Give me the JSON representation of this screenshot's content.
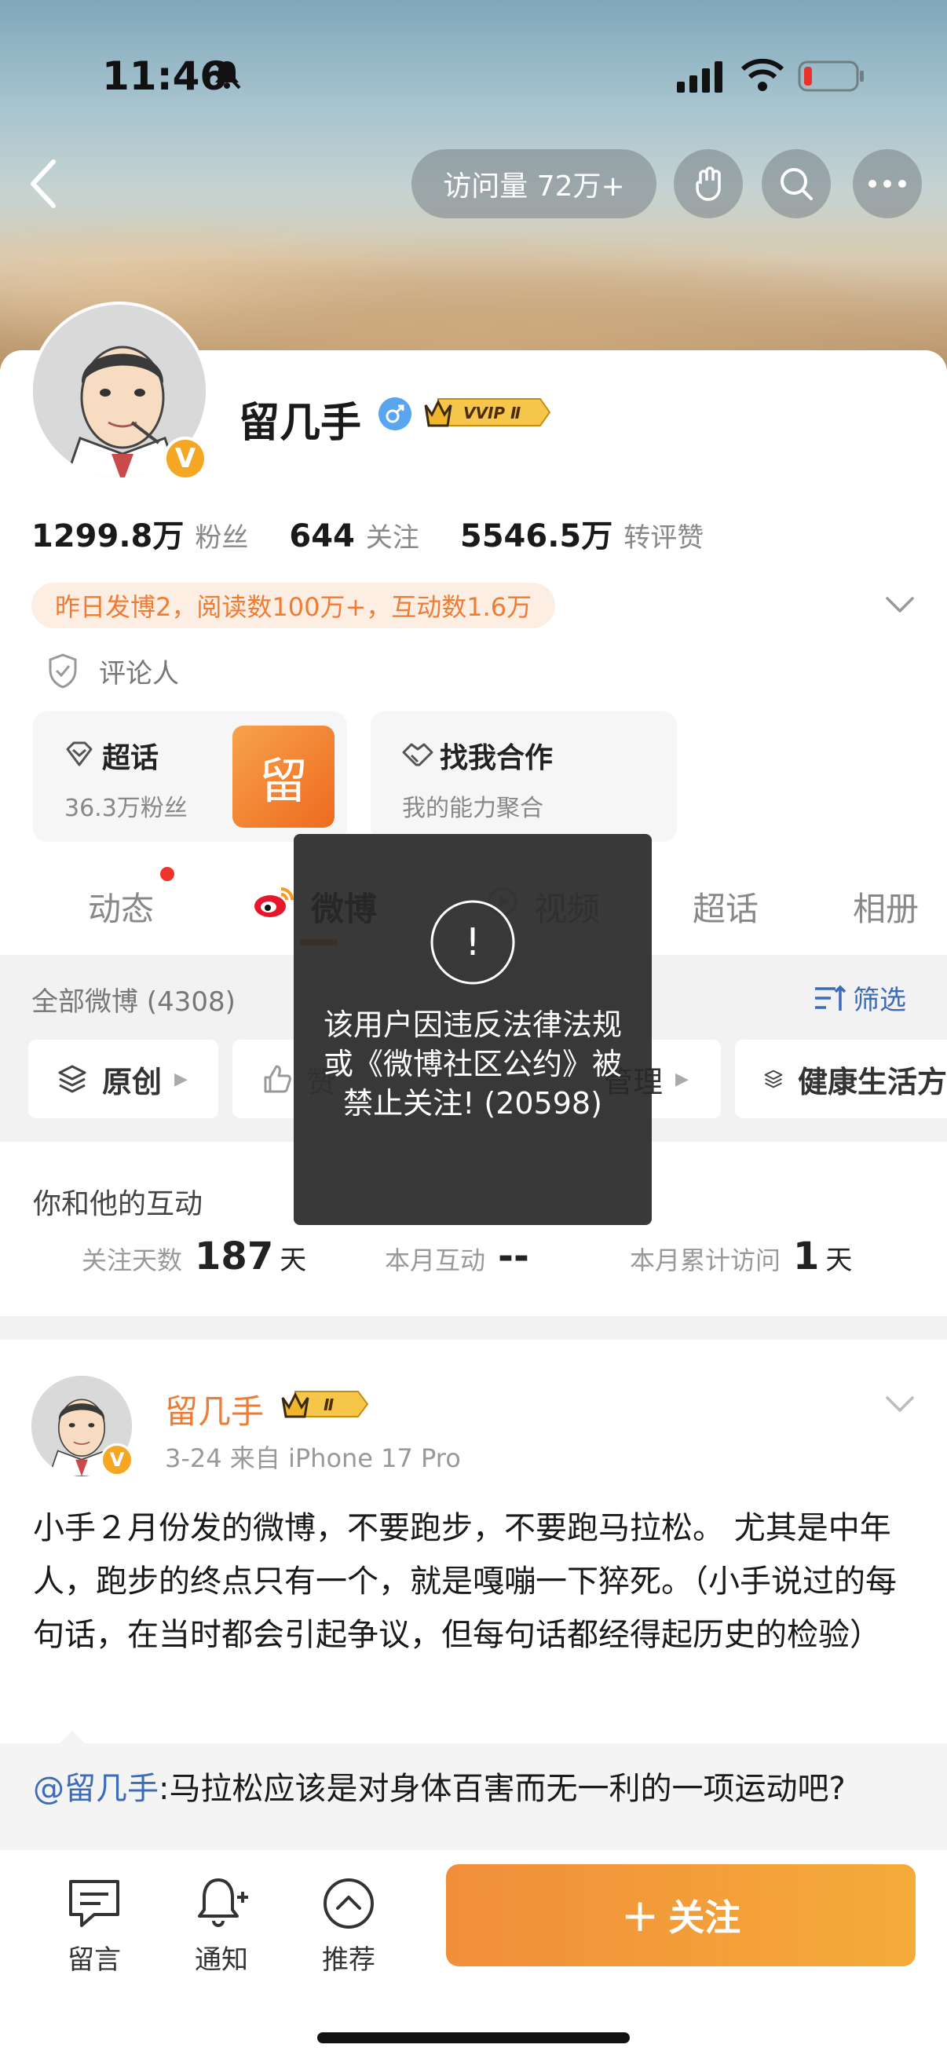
{
  "status_bar": {
    "time": "11:46"
  },
  "header": {
    "visits": "访问量 72万+"
  },
  "profile": {
    "name": "留几手",
    "vip_label": "VVIP Ⅱ",
    "verified_badge": "V",
    "stats": [
      {
        "num": "1299.8万",
        "label": "粉丝"
      },
      {
        "num": "644",
        "label": "关注"
      },
      {
        "num": "5546.5万",
        "label": "转评赞"
      }
    ],
    "yesterday": "昨日发博2，阅读数100万+，互动数1.6万",
    "role": "评论人",
    "cards": {
      "supertopic": {
        "title": "超话",
        "sub": "36.3万粉丝",
        "tile": "留"
      },
      "cooperation": {
        "title": "找我合作",
        "sub": "我的能力聚合"
      }
    }
  },
  "tabs": [
    "动态",
    "微博",
    "视频",
    "超话",
    "相册"
  ],
  "feed": {
    "all_label": "全部微博 (4308)",
    "filter_label": "筛选",
    "chips": [
      "原创",
      "赞",
      "管理",
      "健康生活方"
    ]
  },
  "interaction": {
    "title": "你和他的互动",
    "items": [
      {
        "label": "关注天数",
        "num": "187",
        "unit": "天"
      },
      {
        "label": "本月互动",
        "num": "--",
        "unit": ""
      },
      {
        "label": "本月累计访问",
        "num": "1",
        "unit": "天"
      }
    ]
  },
  "post": {
    "author": "留几手",
    "vip_label": "Ⅱ",
    "meta": "3-24  来自 iPhone 17 Pro",
    "text": "小手２月份发的微博，不要跑步，不要跑马拉松。 尤其是中年人，跑步的终点只有一个，就是嘎嘣一下猝死。（小手说过的每句话，在当时都会引起争议，但每句话都经得起历史的检验）",
    "retweet_at": "@留几手",
    "retweet_text": ":马拉松应该是对身体百害而无一利的一项运动吧?"
  },
  "bottom_bar": {
    "items": [
      "留言",
      "通知",
      "推荐"
    ],
    "follow": "关注",
    "follow_plus": "+"
  },
  "toast": {
    "icon": "!",
    "message": "该用户因违反法律法规或《微博社区公约》被禁止关注! (20598)"
  },
  "colors": {
    "accent": "#f07c33",
    "link": "#3c6bb8",
    "follow_gradient": [
      "#f18e3a",
      "#f5ab39"
    ]
  }
}
